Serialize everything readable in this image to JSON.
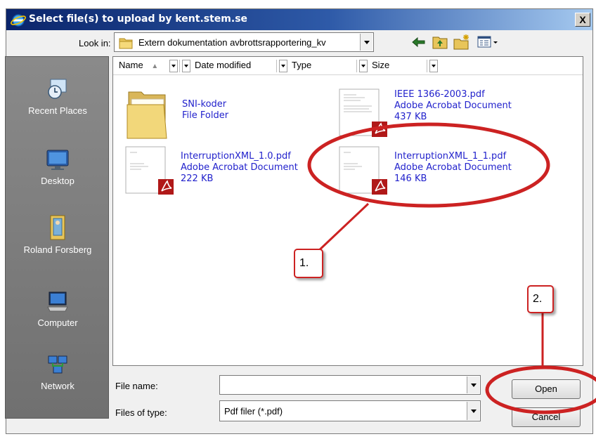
{
  "dialog": {
    "title": "Select file(s) to upload by kent.stem.se",
    "close_glyph": "X"
  },
  "lookin": {
    "label": "Look in:",
    "value": "Extern dokumentation avbrottsrapportering_kv"
  },
  "toolbar": {
    "icons": [
      "back-arrow-icon",
      "up-folder-icon",
      "new-folder-icon",
      "views-menu-icon"
    ]
  },
  "places": [
    {
      "label": "Recent Places",
      "icon": "recent-places-icon"
    },
    {
      "label": "Desktop",
      "icon": "desktop-icon"
    },
    {
      "label": "Roland Forsberg",
      "icon": "user-folder-icon"
    },
    {
      "label": "Computer",
      "icon": "computer-icon"
    },
    {
      "label": "Network",
      "icon": "network-icon"
    }
  ],
  "columns": [
    {
      "label": "Name",
      "sort": "ascending"
    },
    {
      "label": "Date modified"
    },
    {
      "label": "Type"
    },
    {
      "label": "Size"
    }
  ],
  "files": [
    {
      "name": "SNI-koder",
      "type": "File Folder",
      "size": "",
      "icon": "folder-icon"
    },
    {
      "name": "IEEE 1366-2003.pdf",
      "type": "Adobe Acrobat Document",
      "size": "437 KB",
      "icon": "pdf-icon"
    },
    {
      "name": "InterruptionXML_1.0.pdf",
      "type": "Adobe Acrobat Document",
      "size": "222 KB",
      "icon": "pdf-icon"
    },
    {
      "name": "InterruptionXML_1_1.pdf",
      "type": "Adobe Acrobat Document",
      "size": "146 KB",
      "icon": "pdf-icon"
    }
  ],
  "filename": {
    "label": "File name:",
    "value": ""
  },
  "filetype": {
    "label": "Files of type:",
    "value": "Pdf filer (*.pdf)"
  },
  "buttons": {
    "open": "Open",
    "cancel": "Cancel"
  },
  "annotations": [
    {
      "label": "1.",
      "color": "#cc2222"
    },
    {
      "label": "2.",
      "color": "#cc2222"
    }
  ]
}
